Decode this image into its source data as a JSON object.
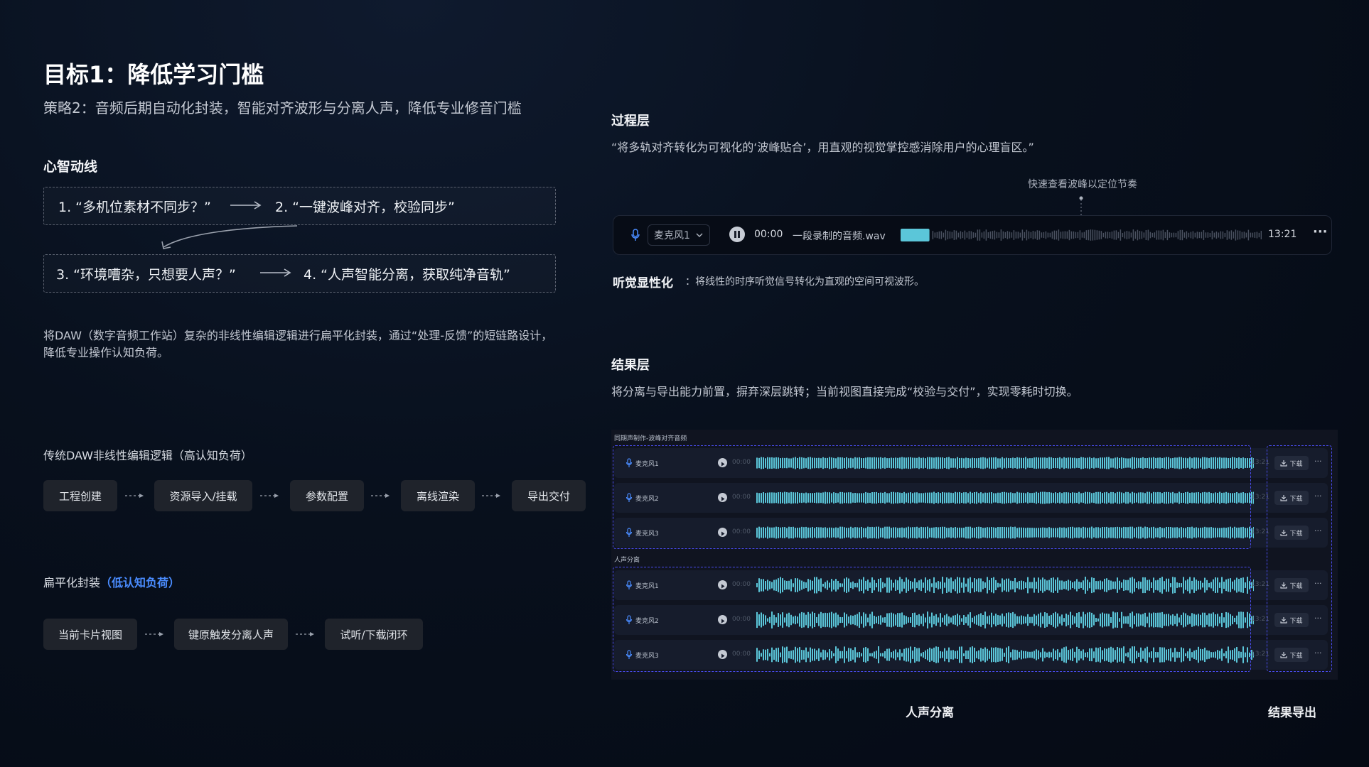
{
  "header": {
    "title": "目标1：降低学习门槛",
    "subtitle": "策略2：音频后期自动化封装，智能对齐波形与分离人声，降低专业修音门槛"
  },
  "mental_flow": {
    "heading": "心智动线",
    "q1": "1. “多机位素材不同步？”",
    "q2": "2. “一键波峰对齐，校验同步”",
    "q3": "3. “环境嘈杂，只想要人声？”",
    "q4": "4. “人声智能分离，获取纯净音轨”"
  },
  "description": {
    "line1": "将DAW（数字音频工作站）复杂的非线性编辑逻辑进行扁平化封装，通过“处理-反馈”的短链路设计，",
    "line2": "降低专业操作认知负荷。"
  },
  "traditional": {
    "heading": "传统DAW非线性编辑逻辑（高认知负荷）",
    "steps": [
      "工程创建",
      "资源导入/挂载",
      "参数配置",
      "离线渲染",
      "导出交付"
    ]
  },
  "flat": {
    "heading": "扁平化封装",
    "heading_highlight": "（低认知负荷）",
    "steps": [
      "当前卡片视图",
      "键原触发分离人声",
      "试听/下载闭环"
    ]
  },
  "process_layer": {
    "heading": "过程层",
    "quote": "“将多轨对齐转化为可视化的‘波峰贴合’，用直观的视觉掌控感消除用户的心理盲区。”",
    "annotation": "快速查看波峰以定位节奏",
    "player": {
      "mic_select": "麦克风1",
      "current_time": "00:00",
      "filename": "一段录制的音频.wav",
      "duration": "13:21",
      "more": "···",
      "progress": 0.08
    },
    "audio_label": "听觉显性化",
    "audio_desc": "：将线性的时序听觉信号转化为直观的空间可视波形。"
  },
  "result_layer": {
    "heading": "结果层",
    "desc": "将分离与导出能力前置，摒弃深层跳转；当前视图直接完成“校验与交付”，实现零耗时切换。",
    "group1_label": "同期声制作-波峰对齐音频",
    "group2_label": "人声分离",
    "tracks": [
      {
        "name": "麦克风1",
        "time": "00:00",
        "end": "13:21",
        "download": "下载",
        "more": "···"
      },
      {
        "name": "麦克风2",
        "time": "00:00",
        "end": "13:21",
        "download": "下载",
        "more": "···"
      },
      {
        "name": "麦克风3",
        "time": "00:00",
        "end": "13:21",
        "download": "下载",
        "more": "···"
      },
      {
        "name": "麦克风1",
        "time": "00:00",
        "end": "13:21",
        "download": "下载",
        "more": "···"
      },
      {
        "name": "麦克风2",
        "time": "00:00",
        "end": "13:21",
        "download": "下载",
        "more": "···"
      },
      {
        "name": "麦克风3",
        "time": "00:00",
        "end": "13:21",
        "download": "下载",
        "more": "···"
      }
    ],
    "footer_left": "人声分离",
    "footer_right": "结果导出"
  },
  "colors": {
    "accent_blue": "#4a8cff",
    "wave_cyan": "#5bc6d9",
    "dash_indigo": "#4a4cf0"
  }
}
